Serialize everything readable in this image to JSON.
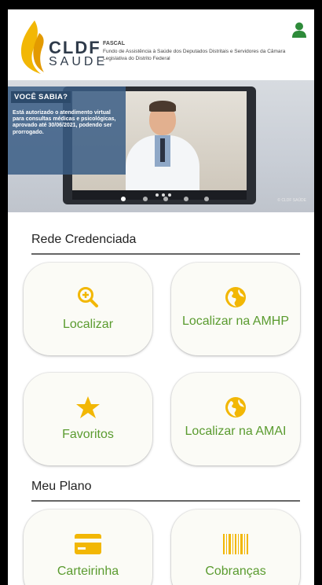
{
  "header": {
    "brand_top": "CLDF",
    "brand_bottom": "SAUDE",
    "org_name": "FASCAL",
    "org_desc": "Fundo de Assistência à Saúde dos Deputados Distritais e Servidores da Câmara Legislativa do Distrito Federal"
  },
  "banner": {
    "badge": "VOCÊ SABIA?",
    "text": "Está autorizado o atendimento virtual para consultas médicas e psicológicas, aprovado até 30/06/2021, podendo ser prorrogado.",
    "credit": "© CLDF SAÚDE"
  },
  "rede": {
    "title": "Rede Credenciada",
    "tiles": [
      {
        "label": "Localizar",
        "icon": "search-plus-icon"
      },
      {
        "label": "Localizar na AMHP",
        "icon": "globe-icon"
      },
      {
        "label": "Favoritos",
        "icon": "star-icon"
      },
      {
        "label": "Localizar na AMAI",
        "icon": "globe-icon"
      }
    ]
  },
  "plano": {
    "title": "Meu Plano",
    "tiles": [
      {
        "label": "Carteirinha",
        "icon": "card-icon"
      },
      {
        "label": "Cobranças",
        "icon": "barcode-icon"
      }
    ]
  },
  "colors": {
    "accent_green": "#5a9b2f",
    "icon_yellow": "#f2b705",
    "user_green": "#2e8b3a"
  }
}
